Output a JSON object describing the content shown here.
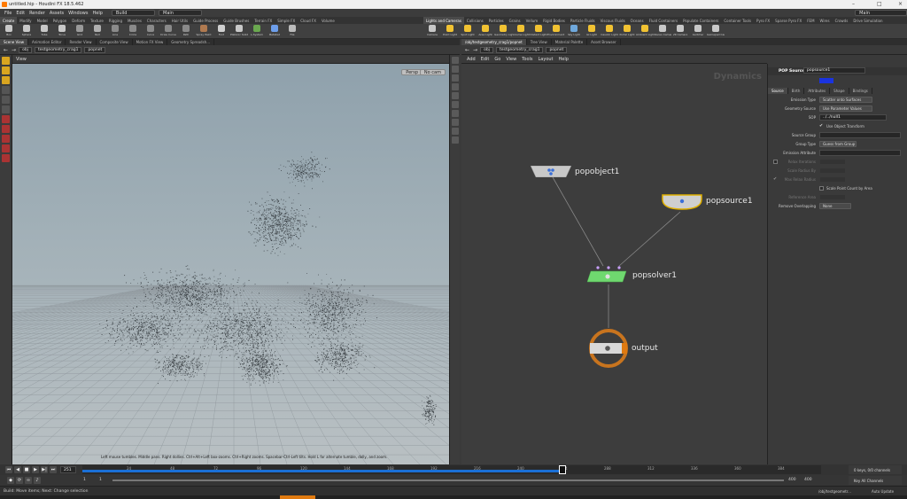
{
  "window": {
    "title": "untitled.hip - Houdini FX 18.5.462"
  },
  "menubar": {
    "items": [
      "File",
      "Edit",
      "Render",
      "Assets",
      "Windows",
      "Help"
    ],
    "desktop": "Build",
    "context": "Main",
    "right_desktop": "Main"
  },
  "shelf_tabs_left": [
    "Create",
    "Modify",
    "Model",
    "Polygon",
    "Deform",
    "Texture",
    "Rigging",
    "Muscles",
    "Characters",
    "Hair Utils",
    "Guide Process",
    "Guide Brushes",
    "Terrain FX",
    "Simple FX",
    "Cloud FX",
    "Volume"
  ],
  "shelf_tabs_right": [
    "Lights and Cameras",
    "Collisions",
    "Particles",
    "Grains",
    "Vellum",
    "Rigid Bodies",
    "Particle Fluids",
    "Viscous Fluids",
    "Oceans",
    "Fluid Containers",
    "Populate Containers",
    "Container Tools",
    "Pyro FX",
    "Sparse Pyro FX",
    "FEM",
    "Wires",
    "Crowds",
    "Drive Simulation"
  ],
  "shelf_tools_left": [
    {
      "label": "Box",
      "color": "#c8c8c8"
    },
    {
      "label": "Sphere",
      "color": "#c8c8c8"
    },
    {
      "label": "Tube",
      "color": "#c8c8c8"
    },
    {
      "label": "Torus",
      "color": "#c8c8c8"
    },
    {
      "label": "Grid",
      "color": "#9a9a9a"
    },
    {
      "label": "Null",
      "color": "#b0b0b0"
    },
    {
      "label": "Line",
      "color": "#8a8a8a"
    },
    {
      "label": "Circle",
      "color": "#8a8a8a"
    },
    {
      "label": "Curve",
      "color": "#8a8a8a"
    },
    {
      "label": "Draw Curve",
      "color": "#8a8a8a"
    },
    {
      "label": "Path",
      "color": "#8a8a8a"
    },
    {
      "label": "Spray Paint",
      "color": "#b07a50"
    },
    {
      "label": "Font",
      "color": "#d0d0d0"
    },
    {
      "label": "Platonic Solids",
      "color": "#c8c8c8"
    },
    {
      "label": "L-System",
      "color": "#6aa84f"
    },
    {
      "label": "Metaball",
      "color": "#6d9eeb"
    },
    {
      "label": "File",
      "color": "#bbbbbb"
    }
  ],
  "shelf_tools_right": [
    {
      "label": "Camera",
      "color": "#c8c8c8"
    },
    {
      "label": "Point Light",
      "color": "#f1c232"
    },
    {
      "label": "Spot Light",
      "color": "#f1c232"
    },
    {
      "label": "Area Light",
      "color": "#f1c232"
    },
    {
      "label": "Geometry Light",
      "color": "#f1c232"
    },
    {
      "label": "Volume Light",
      "color": "#f1c232"
    },
    {
      "label": "Distant Light",
      "color": "#f1c232"
    },
    {
      "label": "Environment Light",
      "color": "#f1c232"
    },
    {
      "label": "Sky Light",
      "color": "#6fa8dc"
    },
    {
      "label": "GI Light",
      "color": "#f1c232"
    },
    {
      "label": "Caustic Light",
      "color": "#f1c232"
    },
    {
      "label": "Portal Light",
      "color": "#f1c232"
    },
    {
      "label": "Ambient Light",
      "color": "#f1c232"
    },
    {
      "label": "Stereo Camera",
      "color": "#c8c8c8"
    },
    {
      "label": "VR Camera",
      "color": "#c8c8c8"
    },
    {
      "label": "Switcher",
      "color": "#c8c8c8"
    },
    {
      "label": "Gamepad Camera",
      "color": "#c8c8c8"
    }
  ],
  "left_pane_tabs": [
    "Scene View",
    "Animation Editor",
    "Render View",
    "Composite View",
    "Motion FX View",
    "Geometry Spreadsh..."
  ],
  "right_pane_tabs": [
    "/obj/testgeometry_crag1/popnet",
    "Tree View",
    "Material Palette",
    "Asset Browser"
  ],
  "left_path": {
    "root": "obj",
    "node": "testgeometry_crag1",
    "leaf": "popnet"
  },
  "right_path": {
    "root": "obj",
    "node": "testgeometry_crag1",
    "leaf": "popnet"
  },
  "viewport": {
    "label": "View",
    "persp": "Persp",
    "cam": "No cam",
    "help": "Left mouse tumbles. Middle pans. Right dollies. Ctrl+Alt+Left box-zooms. Ctrl+Right zooms. Spacebar-Ctrl-Left tilts. Hold L for alternate tumble, dolly, and zoom."
  },
  "network": {
    "menu": [
      "Add",
      "Edit",
      "Go",
      "View",
      "Tools",
      "Layout",
      "Help"
    ],
    "context_label": "Dynamics",
    "nodes": [
      "popobject1",
      "popsource1",
      "popsolver1",
      "output"
    ]
  },
  "params": {
    "node_type": "POP Source",
    "node_name": "popsource1",
    "tabs": [
      "Source",
      "Birth",
      "Attributes",
      "Shape",
      "Bindings"
    ],
    "rows": {
      "emission_type": {
        "label": "Emission Type",
        "value": "Scatter onto Surfaces"
      },
      "geometry_source": {
        "label": "Geometry Source",
        "value": "Use Parameter Values"
      },
      "sop": {
        "label": "SOP",
        "value": "../../null1"
      },
      "use_obj_transform": {
        "label": "Use Object Transform"
      },
      "source_group": {
        "label": "Source Group",
        "value": ""
      },
      "group_type": {
        "label": "Group Type",
        "value": "Guess from Group"
      },
      "emission_attribute": {
        "label": "Emission Attribute",
        "value": ""
      },
      "relax_iterations": {
        "label": "Relax Iterations",
        "value": ""
      },
      "scale_radius_by": {
        "label": "Scale Radius By",
        "value": ""
      },
      "max_relax_radius": {
        "label": "Max Relax Radius",
        "value": ""
      },
      "scale_point_count": {
        "label": "Scale Point Count by Area"
      },
      "reference_area": {
        "label": "Reference Area",
        "value": ""
      },
      "remove_overlapping": {
        "label": "Remove Overlapping",
        "value": "None"
      }
    }
  },
  "timeline": {
    "current_frame": "251",
    "ticks": [
      "24",
      "48",
      "72",
      "96",
      "120",
      "144",
      "168",
      "192",
      "216",
      "240",
      "264",
      "288",
      "312",
      "336",
      "360",
      "384"
    ],
    "progress": 0.65,
    "range_start": "1",
    "range_start2": "1",
    "range_end": "400",
    "range_end2": "400",
    "keys_label": "0 keys, 0/0 channels",
    "key_all": "Key All Channels"
  },
  "status": {
    "text": "Build: Move items; Next: Change selection",
    "path": "/obj/testgeometr...",
    "update": "Auto Update"
  }
}
